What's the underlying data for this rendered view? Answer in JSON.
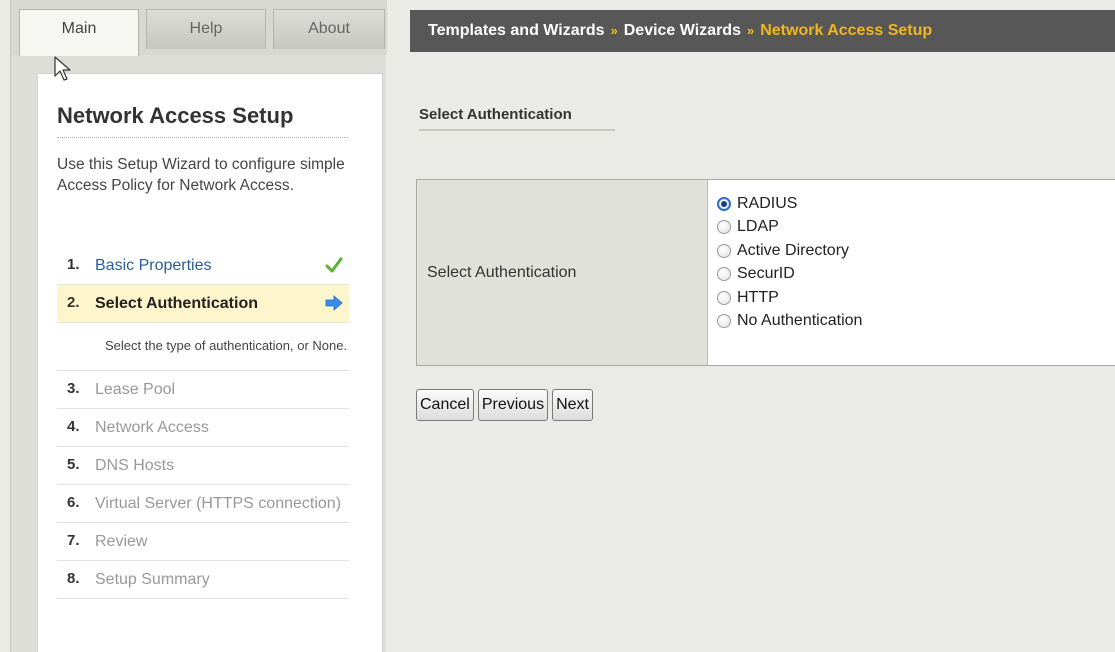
{
  "tabs": [
    {
      "label": "Main",
      "active": true
    },
    {
      "label": "Help",
      "active": false
    },
    {
      "label": "About",
      "active": false
    }
  ],
  "breadcrumb": {
    "items": [
      "Templates and Wizards",
      "Device Wizards"
    ],
    "current": "Network Access Setup",
    "separator": "»"
  },
  "wizard": {
    "title": "Network Access Setup",
    "intro": "Use this Setup Wizard to configure simple Access Policy for Network Access.",
    "steps": [
      {
        "number": "1.",
        "label": "Basic Properties",
        "state": "done",
        "icon": "checkmark-icon"
      },
      {
        "number": "2.",
        "label": "Select Authentication",
        "state": "current",
        "icon": "arrow-right-icon",
        "description": "Select the type of authentication, or None."
      },
      {
        "number": "3.",
        "label": "Lease Pool",
        "state": "pending"
      },
      {
        "number": "4.",
        "label": "Network Access",
        "state": "pending"
      },
      {
        "number": "5.",
        "label": "DNS Hosts",
        "state": "pending"
      },
      {
        "number": "6.",
        "label": "Virtual Server (HTTPS connection)",
        "state": "pending"
      },
      {
        "number": "7.",
        "label": "Review",
        "state": "pending"
      },
      {
        "number": "8.",
        "label": "Setup Summary",
        "state": "pending"
      }
    ]
  },
  "main": {
    "section_title": "Select Authentication",
    "auth_label": "Select Authentication",
    "auth_options": [
      {
        "label": "RADIUS",
        "checked": true
      },
      {
        "label": "LDAP",
        "checked": false
      },
      {
        "label": "Active Directory",
        "checked": false
      },
      {
        "label": "SecurID",
        "checked": false
      },
      {
        "label": "HTTP",
        "checked": false
      },
      {
        "label": "No Authentication",
        "checked": false
      }
    ],
    "buttons": {
      "cancel": "Cancel",
      "previous": "Previous",
      "next": "Next"
    }
  },
  "colors": {
    "breadcrumb_bg": "#575757",
    "breadcrumb_current": "#f0b61c",
    "current_step_bg": "#fdf6cc",
    "done_step_link": "#2a5d9a",
    "checkmark": "#5ab232",
    "arrow": "#3a8ee6"
  }
}
